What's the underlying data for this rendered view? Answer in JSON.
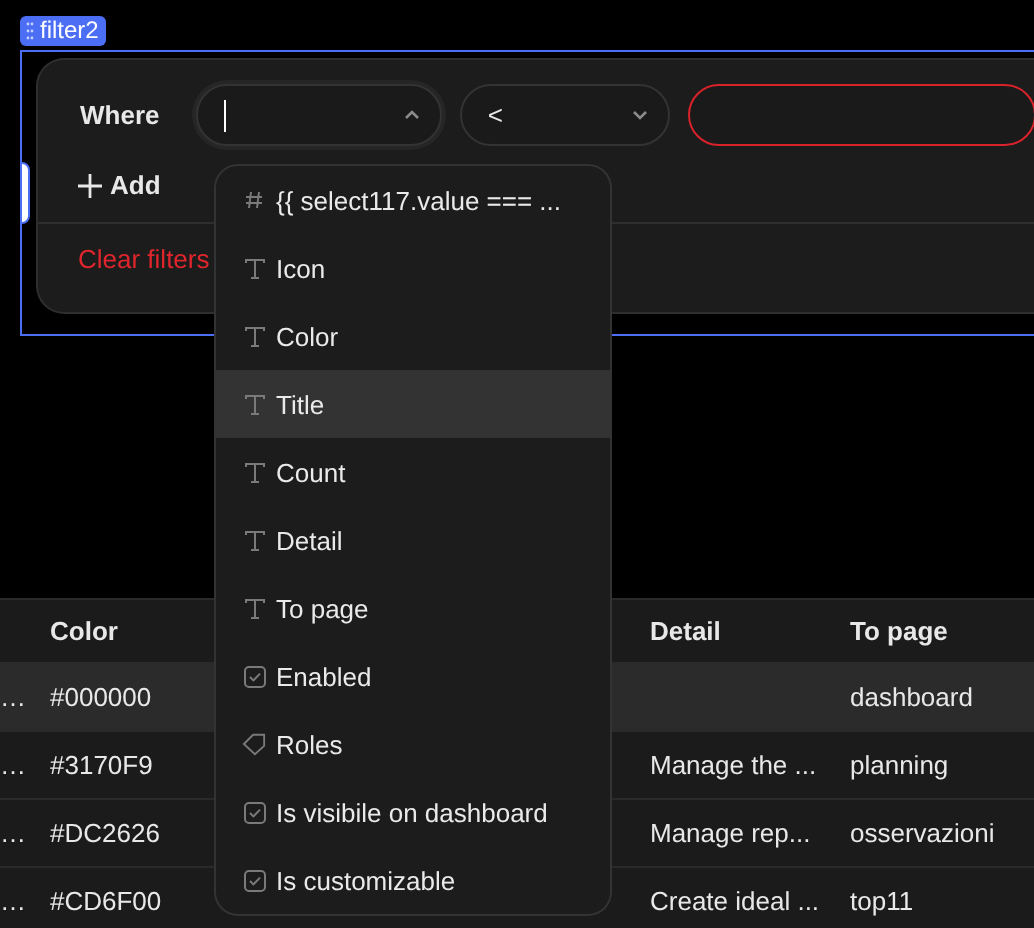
{
  "filter_tag": {
    "label": "filter2"
  },
  "filter": {
    "where_label": "Where",
    "fields": [
      {
        "kind": "select",
        "expanded": true,
        "focused": true,
        "invalid": false
      },
      {
        "kind": "select",
        "value": "<",
        "expanded": false,
        "focused": false,
        "invalid": false
      },
      {
        "kind": "input",
        "focused": false,
        "invalid": true
      }
    ],
    "add_button": "Add",
    "clear_button": "Clear filters"
  },
  "dropdown": {
    "items": [
      {
        "label": "{{ select117.value === ...",
        "kind": "hash",
        "selected": false
      },
      {
        "label": "Icon",
        "kind": "text",
        "selected": false
      },
      {
        "label": "Color",
        "kind": "text",
        "selected": false
      },
      {
        "label": "Title",
        "kind": "text",
        "selected": true
      },
      {
        "label": "Count",
        "kind": "text",
        "selected": false
      },
      {
        "label": "Detail",
        "kind": "text",
        "selected": false
      },
      {
        "label": "To page",
        "kind": "text",
        "selected": false
      },
      {
        "label": "Enabled",
        "kind": "checkbox",
        "selected": false
      },
      {
        "label": "Roles",
        "kind": "tag",
        "selected": false
      },
      {
        "label": "Is visibile on dashboard",
        "kind": "checkbox",
        "selected": false
      },
      {
        "label": "Is customizable",
        "kind": "checkbox",
        "selected": false
      }
    ]
  },
  "table": {
    "columns": [
      "Color",
      "Detail",
      "To page"
    ],
    "rows": [
      {
        "column_1": "…",
        "color_code": "#000000",
        "to_page": "dashboard",
        "selected": true
      },
      {
        "column_1": "…",
        "color_code": "#3170F9",
        "detail": "Manage the ...",
        "to_page": "planning",
        "selected": false
      },
      {
        "column_1": "…",
        "color_code": "#DC2626",
        "detail": "Manage rep...",
        "to_page": "osservazioni",
        "selected": false
      },
      {
        "column_1": "…",
        "color_code": "#CD6F00",
        "detail": "Create ideal ...",
        "to_page": "top11",
        "selected": false
      }
    ]
  }
}
